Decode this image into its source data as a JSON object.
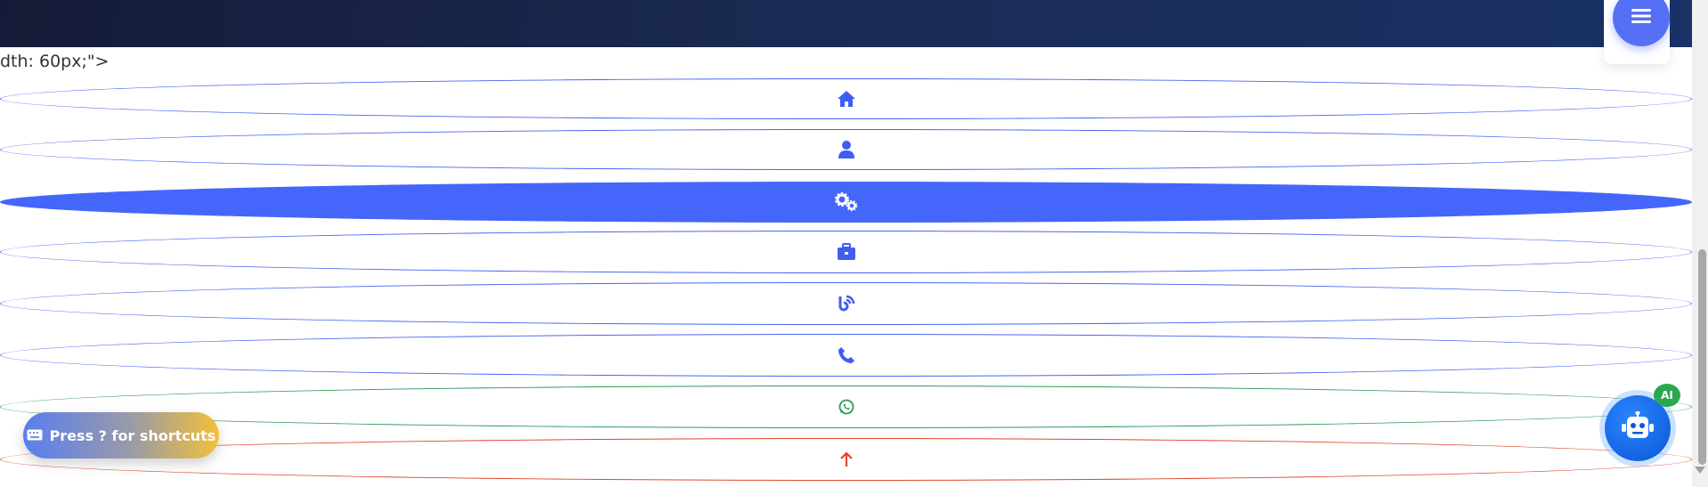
{
  "stray_text": "dth: 60px;\">",
  "nav": {
    "items": [
      {
        "name": "nav-home",
        "icon": "home-icon",
        "state": "inactive",
        "color": "#4a64f3"
      },
      {
        "name": "nav-about",
        "icon": "user-icon",
        "state": "inactive",
        "color": "#4a64f3"
      },
      {
        "name": "nav-services",
        "icon": "cogs-icon",
        "state": "active",
        "color": "#4566fb"
      },
      {
        "name": "nav-portfolio",
        "icon": "briefcase-icon",
        "state": "inactive",
        "color": "#4a64f3"
      },
      {
        "name": "nav-blog",
        "icon": "blog-icon",
        "state": "inactive",
        "color": "#4a64f3"
      },
      {
        "name": "nav-contact",
        "icon": "phone-icon",
        "state": "inactive",
        "color": "#4a64f3"
      },
      {
        "name": "nav-whatsapp",
        "icon": "whatsapp-icon",
        "state": "inactive",
        "color": "#2e9a57"
      },
      {
        "name": "nav-back-to-top",
        "icon": "arrow-up-icon",
        "state": "inactive",
        "color": "#e0482a"
      }
    ]
  },
  "shortcuts": {
    "icon": "keyboard-icon",
    "label": "Press ? for shortcuts"
  },
  "ai_assistant": {
    "icon": "robot-icon",
    "badge": "AI"
  },
  "menu": {
    "icon": "hamburger-icon"
  },
  "colors": {
    "header": "#1a2a52",
    "accent": "#4566fb",
    "whatsapp": "#2e9a57",
    "top": "#e0482a"
  }
}
